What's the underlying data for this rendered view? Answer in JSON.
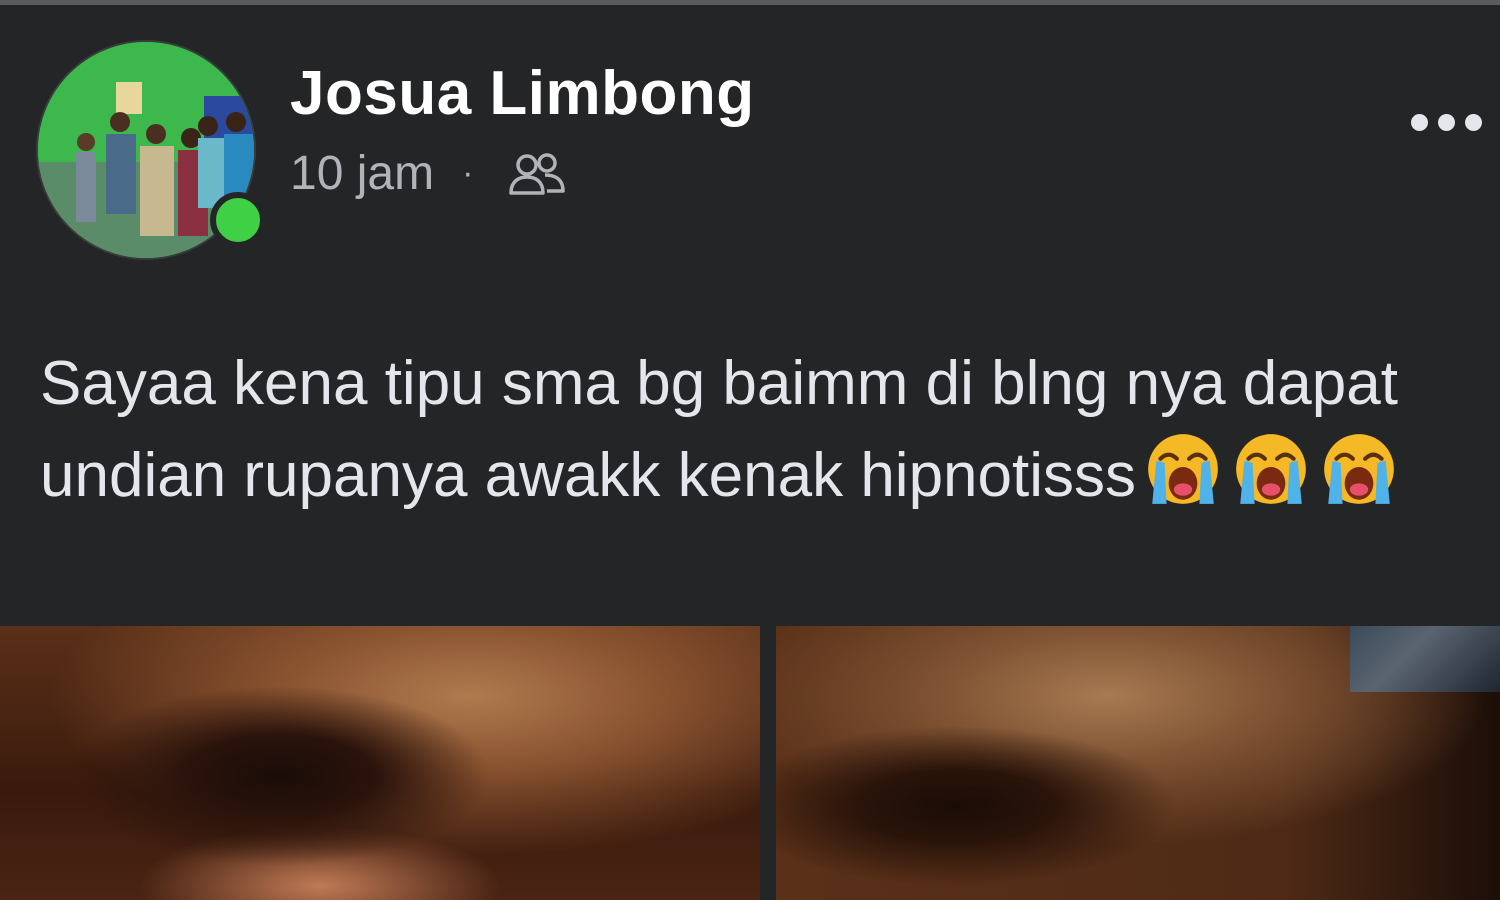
{
  "post": {
    "author_name": "Josua Limbong",
    "time": "10 jam",
    "separator": "·",
    "audience_icon": "friends-icon",
    "more_icon": "more-options-icon",
    "text": "Sayaa kena tipu sma bg baimm di blng nya dapat undian rupanya awakk kenak hipnotisss",
    "emojis": [
      "loudly-crying-face",
      "loudly-crying-face",
      "loudly-crying-face"
    ],
    "online_status_color": "#3fd045"
  },
  "theme": {
    "background": "#242526",
    "text_primary": "#e4e6eb",
    "text_secondary": "#b0b3b8"
  }
}
